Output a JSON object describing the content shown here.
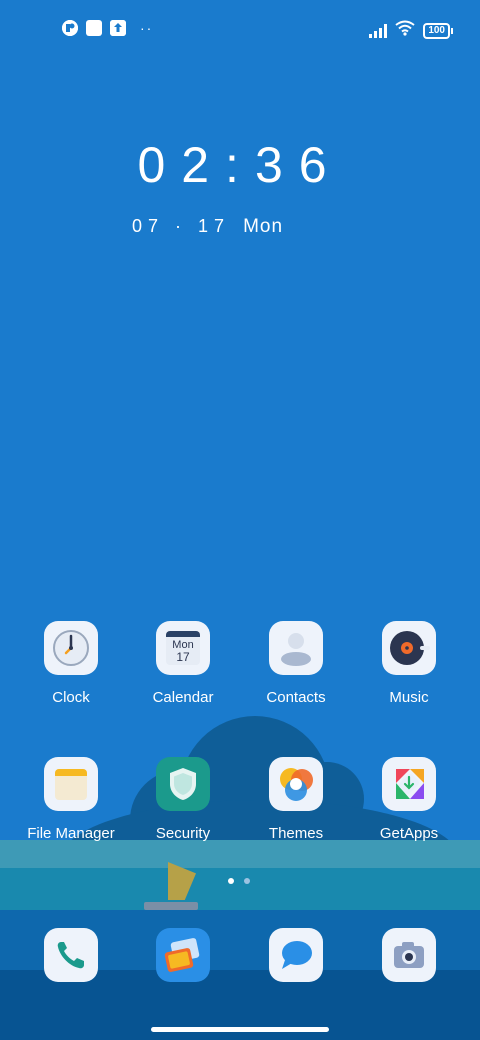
{
  "status_bar": {
    "battery": "100",
    "icons": [
      "notification-app-icon",
      "square-icon",
      "upload-icon",
      "more-dots-icon",
      "signal-icon",
      "wifi-icon",
      "battery-icon"
    ],
    "dots": "··"
  },
  "clock": {
    "time": "02:36",
    "date": "07 · 17",
    "weekday": "Mon"
  },
  "apps_row1": [
    {
      "label": "Clock",
      "icon": "clock-icon"
    },
    {
      "label": "Calendar",
      "icon": "calendar-icon",
      "cal_day": "Mon",
      "cal_date": "17"
    },
    {
      "label": "Contacts",
      "icon": "contacts-icon"
    },
    {
      "label": "Music",
      "icon": "music-icon"
    }
  ],
  "apps_row2": [
    {
      "label": "File Manager",
      "icon": "file-manager-icon"
    },
    {
      "label": "Security",
      "icon": "security-shield-icon"
    },
    {
      "label": "Themes",
      "icon": "themes-icon"
    },
    {
      "label": "GetApps",
      "icon": "getapps-icon"
    }
  ],
  "dock": [
    {
      "icon": "phone-icon"
    },
    {
      "icon": "gallery-icon"
    },
    {
      "icon": "messages-icon"
    },
    {
      "icon": "camera-icon"
    }
  ],
  "pager": {
    "pages": 2,
    "active": 1
  }
}
